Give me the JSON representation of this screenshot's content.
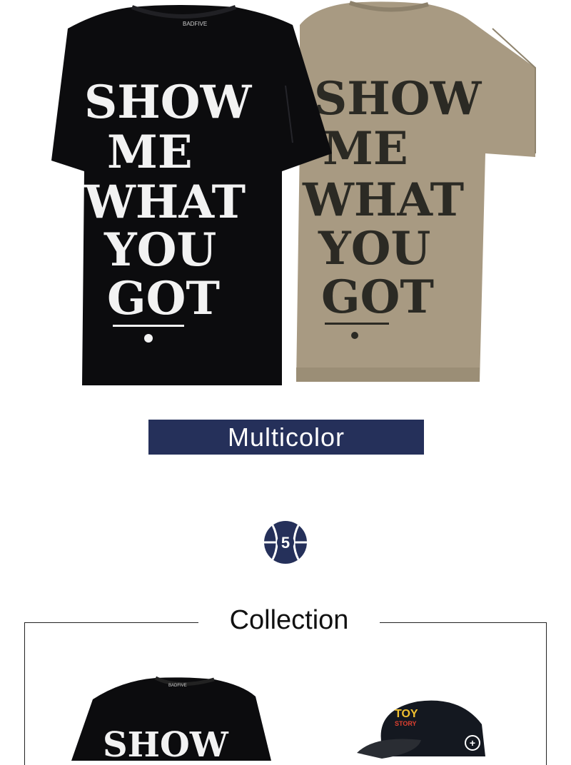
{
  "hero": {
    "print_lines": [
      "SHOW",
      "ME",
      "WHAT",
      "YOU",
      "GOT"
    ],
    "brand_tag": "BADFIVE",
    "shirt_colors": {
      "black": "#0c0c0e",
      "khaki": "#a89a82"
    }
  },
  "banner": {
    "label": "Multicolor",
    "color": "#25305a"
  },
  "logo": {
    "number": "5",
    "icon": "basketball-5-icon"
  },
  "collection": {
    "title": "Collection",
    "items": [
      {
        "icon": "black-tshirt-thumbnail",
        "print": "SHOW"
      },
      {
        "icon": "toy-story-cap-thumbnail",
        "cap_text_top": "TOY",
        "cap_text_bottom": "STORY",
        "badge": "+"
      }
    ]
  }
}
